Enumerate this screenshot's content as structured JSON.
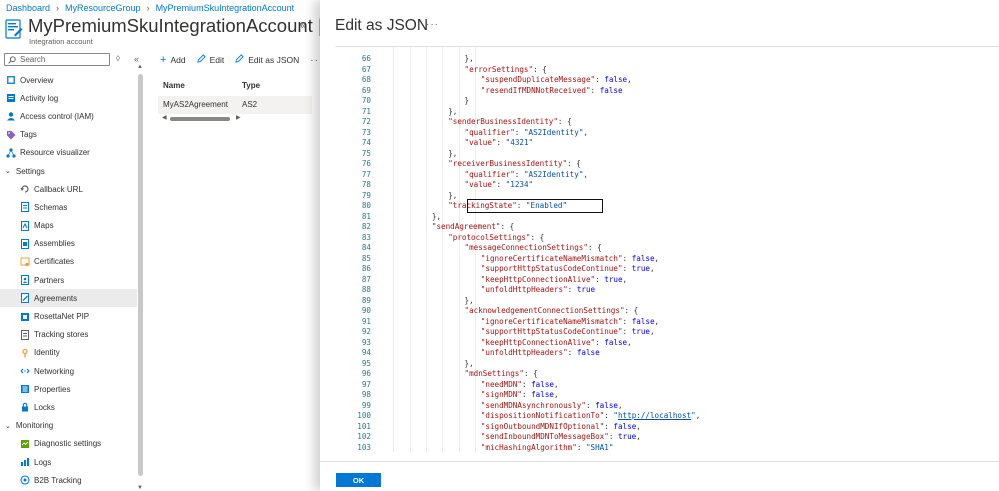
{
  "breadcrumb": [
    {
      "label": "Dashboard"
    },
    {
      "label": "MyResourceGroup"
    },
    {
      "label": "MyPremiumSkuIntegrationAccount"
    }
  ],
  "resource": {
    "title": "MyPremiumSkuIntegrationAccount | Ag...",
    "subtitle": "Integration account",
    "collapse_glyph": "«"
  },
  "search": {
    "placeholder": "Search",
    "button1": "◊",
    "button2": "«"
  },
  "nav": [
    {
      "label": "Overview",
      "icon": "overview-icon",
      "level": 0
    },
    {
      "label": "Activity log",
      "icon": "activity-log-icon",
      "level": 0
    },
    {
      "label": "Access control (IAM)",
      "icon": "iam-icon",
      "level": 0
    },
    {
      "label": "Tags",
      "icon": "tag-icon",
      "level": 0
    },
    {
      "label": "Resource visualizer",
      "icon": "visualizer-icon",
      "level": 0
    },
    {
      "label": "Settings",
      "icon": "chevron-down-icon",
      "level": "group"
    },
    {
      "label": "Callback URL",
      "icon": "callback-icon",
      "level": 1
    },
    {
      "label": "Schemas",
      "icon": "schema-icon",
      "level": 1
    },
    {
      "label": "Maps",
      "icon": "map-icon",
      "level": 1
    },
    {
      "label": "Assemblies",
      "icon": "assembly-icon",
      "level": 1
    },
    {
      "label": "Certificates",
      "icon": "certificate-icon",
      "level": 1
    },
    {
      "label": "Partners",
      "icon": "partner-icon",
      "level": 1
    },
    {
      "label": "Agreements",
      "icon": "agreement-icon",
      "level": 1,
      "active": true
    },
    {
      "label": "RosettaNet PIP",
      "icon": "rosettanet-icon",
      "level": 1
    },
    {
      "label": "Tracking stores",
      "icon": "tracking-store-icon",
      "level": 1
    },
    {
      "label": "Identity",
      "icon": "identity-icon",
      "level": 1
    },
    {
      "label": "Networking",
      "icon": "networking-icon",
      "level": 1
    },
    {
      "label": "Properties",
      "icon": "properties-icon",
      "level": 1
    },
    {
      "label": "Locks",
      "icon": "lock-icon",
      "level": 1
    },
    {
      "label": "Monitoring",
      "icon": "chevron-down-icon",
      "level": "group"
    },
    {
      "label": "Diagnostic settings",
      "icon": "diagnostic-icon",
      "level": 1
    },
    {
      "label": "Logs",
      "icon": "logs-icon",
      "level": 1
    },
    {
      "label": "B2B Tracking",
      "icon": "b2b-tracking-icon",
      "level": 1
    }
  ],
  "toolbar": {
    "add_label": "Add",
    "edit_label": "Edit",
    "edit_json_label": "Edit as JSON",
    "more_label": "···"
  },
  "grid": {
    "columns": [
      "Name",
      "Type"
    ],
    "rows": [
      [
        "MyAS2Agreement",
        "AS2"
      ]
    ]
  },
  "editor": {
    "title": "Edit as JSON",
    "more_label": "···",
    "lines": [
      {
        "n": "66",
        "indent": 5,
        "text": "},"
      },
      {
        "n": "67",
        "indent": 5,
        "text": "\"errorSettings\": {"
      },
      {
        "n": "68",
        "indent": 6,
        "text": "\"suspendDuplicateMessage\": false,"
      },
      {
        "n": "69",
        "indent": 6,
        "text": "\"resendIfMDNNotReceived\": false"
      },
      {
        "n": "70",
        "indent": 5,
        "text": "}"
      },
      {
        "n": "71",
        "indent": 4,
        "text": "},"
      },
      {
        "n": "72",
        "indent": 4,
        "text": "\"senderBusinessIdentity\": {"
      },
      {
        "n": "73",
        "indent": 5,
        "text": "\"qualifier\": \"AS2Identity\","
      },
      {
        "n": "74",
        "indent": 5,
        "text": "\"value\": \"4321\""
      },
      {
        "n": "75",
        "indent": 4,
        "text": "},"
      },
      {
        "n": "76",
        "indent": 4,
        "text": "\"receiverBusinessIdentity\": {"
      },
      {
        "n": "77",
        "indent": 5,
        "text": "\"qualifier\": \"AS2Identity\","
      },
      {
        "n": "78",
        "indent": 5,
        "text": "\"value\": \"1234\""
      },
      {
        "n": "79",
        "indent": 4,
        "text": "},"
      },
      {
        "n": "80",
        "indent": 4,
        "text": "\"trackingState\": \"Enabled\""
      },
      {
        "n": "81",
        "indent": 3,
        "text": "},"
      },
      {
        "n": "82",
        "indent": 3,
        "text": "\"sendAgreement\": {"
      },
      {
        "n": "83",
        "indent": 4,
        "text": "\"protocolSettings\": {"
      },
      {
        "n": "84",
        "indent": 5,
        "text": "\"messageConnectionSettings\": {"
      },
      {
        "n": "85",
        "indent": 6,
        "text": "\"ignoreCertificateNameMismatch\": false,"
      },
      {
        "n": "86",
        "indent": 6,
        "text": "\"supportHttpStatusCodeContinue\": true,"
      },
      {
        "n": "87",
        "indent": 6,
        "text": "\"keepHttpConnectionAlive\": true,"
      },
      {
        "n": "88",
        "indent": 6,
        "text": "\"unfoldHttpHeaders\": true"
      },
      {
        "n": "89",
        "indent": 5,
        "text": "},"
      },
      {
        "n": "90",
        "indent": 5,
        "text": "\"acknowledgementConnectionSettings\": {"
      },
      {
        "n": "91",
        "indent": 6,
        "text": "\"ignoreCertificateNameMismatch\": false,"
      },
      {
        "n": "92",
        "indent": 6,
        "text": "\"supportHttpStatusCodeContinue\": true,"
      },
      {
        "n": "93",
        "indent": 6,
        "text": "\"keepHttpConnectionAlive\": false,"
      },
      {
        "n": "94",
        "indent": 6,
        "text": "\"unfoldHttpHeaders\": false"
      },
      {
        "n": "95",
        "indent": 5,
        "text": "},"
      },
      {
        "n": "96",
        "indent": 5,
        "text": "\"mdnSettings\": {"
      },
      {
        "n": "97",
        "indent": 6,
        "text": "\"needMDN\": false,"
      },
      {
        "n": "98",
        "indent": 6,
        "text": "\"signMDN\": false,"
      },
      {
        "n": "99",
        "indent": 6,
        "text": "\"sendMDNAsynchronously\": false,"
      },
      {
        "n": "100",
        "indent": 6,
        "text": "\"dispositionNotificationTo\": \"http://localhost\","
      },
      {
        "n": "101",
        "indent": 6,
        "text": "\"signOutboundMDNIfOptional\": false,"
      },
      {
        "n": "102",
        "indent": 6,
        "text": "\"sendInboundMDNToMessageBox\": true,"
      },
      {
        "n": "103",
        "indent": 6,
        "text": "\"micHashingAlgorithm\": \"SHA1\""
      }
    ]
  },
  "footer": {
    "ok_label": "OK"
  },
  "colors": {
    "accent": "#0078d4",
    "json_key": "#a31515",
    "json_string": "#0451a5",
    "json_keyword": "#0000ff",
    "line_number": "#237893"
  }
}
